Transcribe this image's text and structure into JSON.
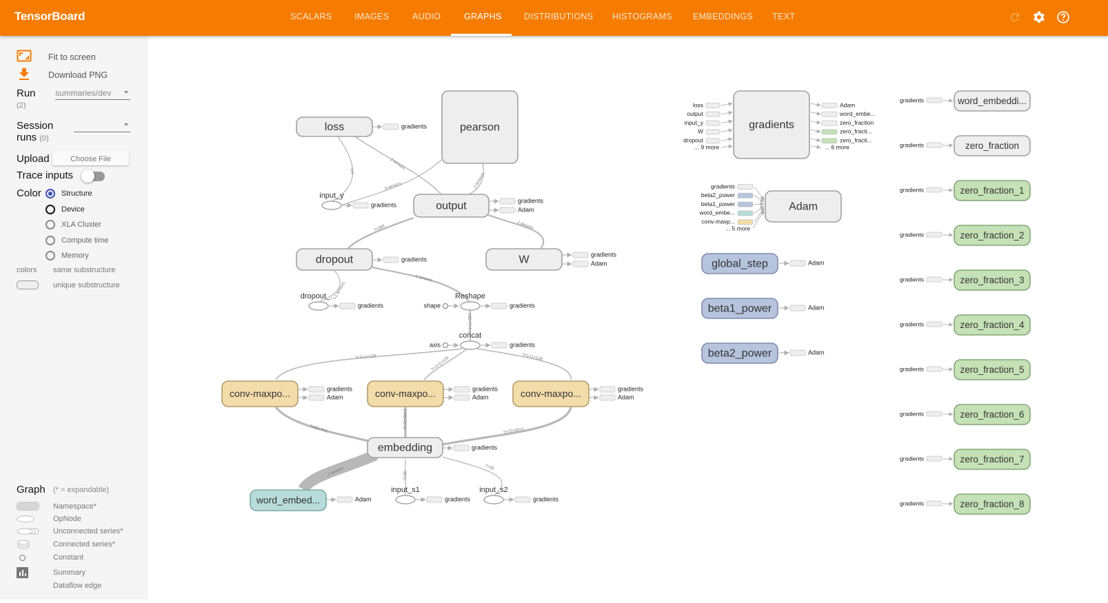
{
  "app": {
    "title": "TensorBoard",
    "tabs": [
      {
        "label": "SCALARS",
        "active": false
      },
      {
        "label": "IMAGES",
        "active": false
      },
      {
        "label": "AUDIO",
        "active": false
      },
      {
        "label": "GRAPHS",
        "active": true
      },
      {
        "label": "DISTRIBUTIONS",
        "active": false
      },
      {
        "label": "HISTOGRAMS",
        "active": false
      },
      {
        "label": "EMBEDDINGS",
        "active": false
      },
      {
        "label": "TEXT",
        "active": false
      }
    ],
    "icons": {
      "reload": "refresh-icon",
      "settings": "gear-icon",
      "help": "help-icon"
    }
  },
  "sidebar": {
    "fit_to_screen": "Fit to screen",
    "download_png": "Download PNG",
    "run_label": "Run",
    "run_count": "(2)",
    "run_value": "summaries/dev",
    "session_label_1": "Session",
    "session_label_2": "runs",
    "session_count": "(0)",
    "session_value": "",
    "upload_label": "Upload",
    "choose_file": "Choose File",
    "trace_inputs_label": "Trace inputs",
    "trace_inputs_on": false,
    "color_label": "Color",
    "color_options": [
      {
        "label": "Structure",
        "selected": true
      },
      {
        "label": "Device",
        "selected": false
      },
      {
        "label": "XLA Cluster",
        "selected": false
      },
      {
        "label": "Compute time",
        "selected": false
      },
      {
        "label": "Memory",
        "selected": false
      }
    ],
    "colors_label": "colors",
    "same_substructure": "same substructure",
    "unique_substructure": "unique substructure",
    "graph_label": "Graph",
    "expandable_note": "(* = expandable)",
    "legend": [
      {
        "label": "Namespace*"
      },
      {
        "label": "OpNode"
      },
      {
        "label": "Unconnected series*"
      },
      {
        "label": "Connected series*"
      },
      {
        "label": "Constant"
      },
      {
        "label": "Summary"
      },
      {
        "label": "Dataflow edge"
      }
    ]
  },
  "graph": {
    "colors": {
      "namespace_fill": "#eeeeee",
      "conv_fill": "#f2dcaa",
      "word_embed_fill": "#b8dcda",
      "variable_fill": "#b7c4dd",
      "zero_fraction_fill": "#c5e1b6",
      "edge": "#b8b8b8"
    },
    "main_nodes": {
      "loss": "loss",
      "pearson": "pearson",
      "output": "output",
      "dropout": "dropout",
      "W": "W",
      "conv1": "conv-maxpo...",
      "conv2": "conv-maxpo...",
      "conv3": "conv-maxpo...",
      "embedding": "embedding",
      "word_embed": "word_embed..."
    },
    "op_nodes": {
      "input_y": "input_y",
      "dropout_keep": "dropout_...",
      "reshape": "Reshape",
      "concat": "concat",
      "input_s1": "input_s1",
      "input_s2": "input_s2",
      "shape": "shape",
      "axis": "axis"
    },
    "edge_labels": {
      "loss_input_y": "?×1",
      "loss_output": "2 tensors",
      "pearson_input_y": "8 tensors",
      "pearson_output": "2 tensors",
      "output_dropout": "?×384",
      "output_W": "2 tensors",
      "dropout_keep": "2 tensors",
      "dropout_reshape": "2 tensors",
      "reshape_concat": "?×1×1×384",
      "concat_conv1": "?×1×1×128",
      "concat_conv2": "?×1×1×128",
      "concat_conv3": "?×1×1×128",
      "embedding_conv1": "?×60×?×1",
      "embedding_conv2": "?×?2×50×1",
      "embedding_conv3": "?×?2×50×1",
      "word_embedding": "2 tensors",
      "embedding_input_s1": "?×30",
      "embedding_input_s2": "?×30"
    },
    "aux": {
      "gradients": "gradients",
      "adam": "Adam"
    },
    "gradients_node": {
      "label": "gradients",
      "inputs": [
        "loss",
        "output",
        "input_y",
        "W",
        "dropout"
      ],
      "inputs_more": "... 9 more",
      "outputs": [
        "Adam",
        "word_embe...",
        "zero_fraction",
        "zero_fracti...",
        "zero_fracti..."
      ],
      "outputs_more": "... 6 more"
    },
    "adam_node": {
      "label": "Adam",
      "inputs": [
        "gradients",
        "beta2_power",
        "beta1_power",
        "word_embe...",
        "conv-maxp..."
      ],
      "inputs_more": "... 5 more"
    },
    "variables": [
      "global_step",
      "beta1_power",
      "beta2_power"
    ],
    "summary_nodes": [
      "word_embeddi...",
      "zero_fraction",
      "zero_fraction_1",
      "zero_fraction_2",
      "zero_fraction_3",
      "zero_fraction_4",
      "zero_fraction_5",
      "zero_fraction_6",
      "zero_fraction_7",
      "zero_fraction_8"
    ]
  }
}
